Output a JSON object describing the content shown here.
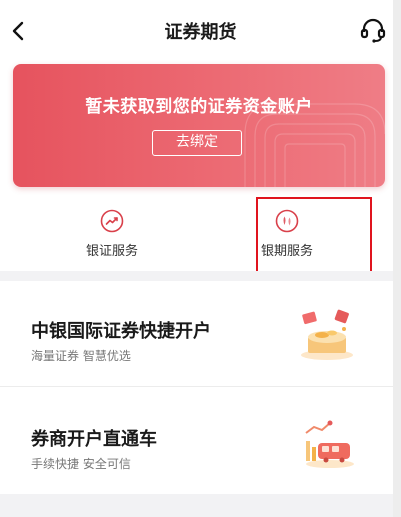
{
  "header": {
    "title": "证券期货",
    "back_icon": "chevron-left-icon",
    "support_icon": "headset-icon"
  },
  "banner": {
    "message": "暂未获取到您的证券资金账户",
    "bind_button": "去绑定",
    "colors": {
      "start": "#e6535e",
      "end": "#ef7d86"
    }
  },
  "services": [
    {
      "label": "银证服务",
      "icon": "trend-icon"
    },
    {
      "label": "银期服务",
      "icon": "futures-icon"
    }
  ],
  "cards": [
    {
      "title": "中银国际证券快捷开户",
      "subtitle": "海量证券  智慧优选",
      "icon": "gift-box-illustration"
    },
    {
      "title": "券商开户直通车",
      "subtitle": "手续快捷  安全可信",
      "icon": "train-chart-illustration"
    }
  ],
  "accent_color": "#e0141e"
}
